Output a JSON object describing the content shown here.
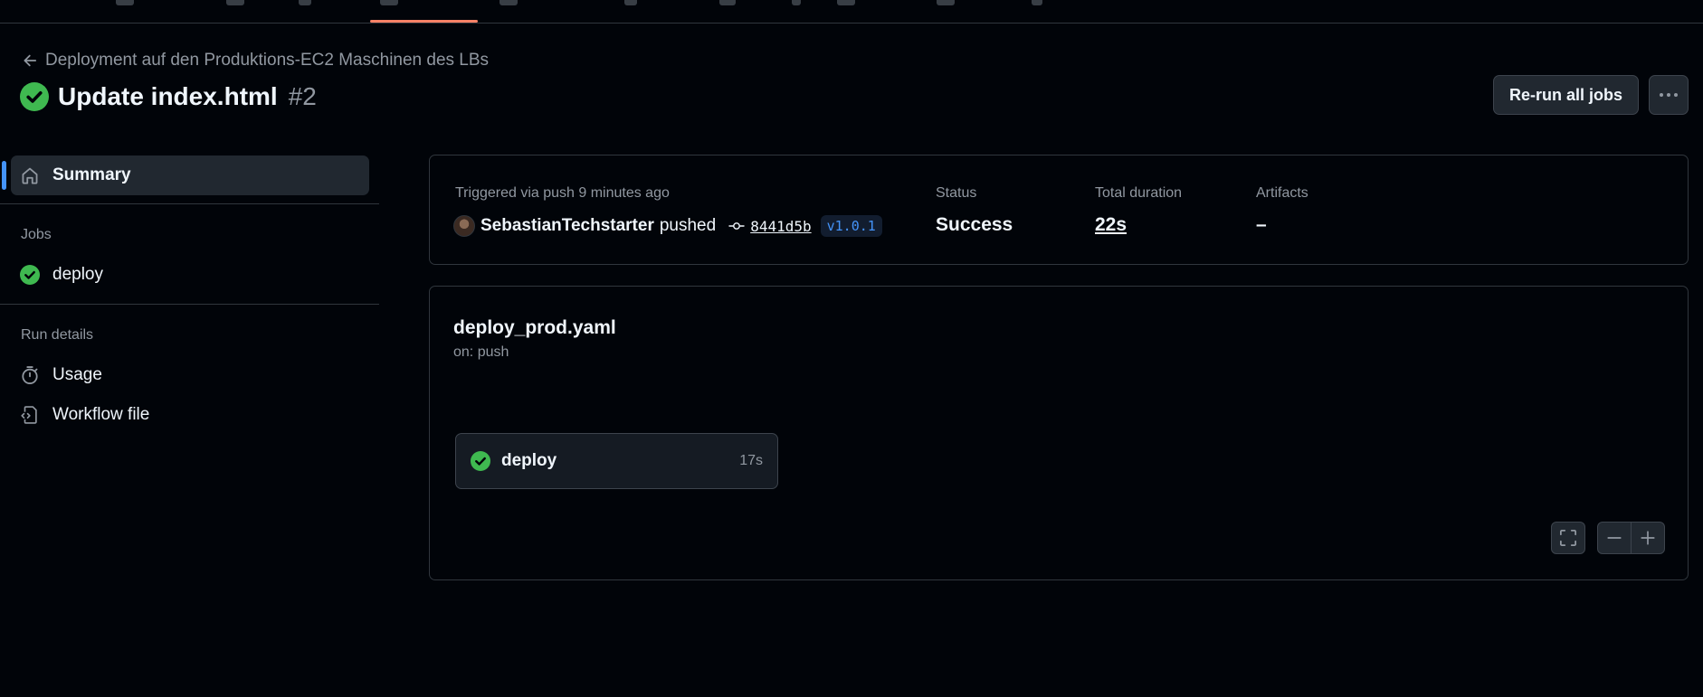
{
  "header": {
    "back_link": "Deployment auf den Produktions-EC2 Maschinen des LBs",
    "title": "Update index.html",
    "run_number": "#2",
    "rerun_button": "Re-run all jobs",
    "more_button": "···"
  },
  "sidebar": {
    "summary": "Summary",
    "jobs_heading": "Jobs",
    "jobs": [
      {
        "label": "deploy",
        "status": "success"
      }
    ],
    "run_details_heading": "Run details",
    "usage": "Usage",
    "workflow_file": "Workflow file"
  },
  "summary": {
    "trigger_text": "Triggered via push 9 minutes ago",
    "actor": "SebastianTechstarter",
    "action": "pushed",
    "commit_sha": "8441d5b",
    "tag": "v1.0.1",
    "status_label": "Status",
    "status_value": "Success",
    "duration_label": "Total duration",
    "duration_value": "22s",
    "artifacts_label": "Artifacts",
    "artifacts_value": "–"
  },
  "workflow": {
    "file": "deploy_prod.yaml",
    "trigger": "on: push",
    "job_name": "deploy",
    "job_duration": "17s"
  },
  "colors": {
    "background": "#010409",
    "success_green": "#3fb950",
    "accent_blue": "#4493f8",
    "tab_underline": "#f78166"
  },
  "icons": [
    "arrow-left-icon",
    "check-circle-icon",
    "kebab-icon",
    "home-icon",
    "stopwatch-icon",
    "workflow-file-icon",
    "git-commit-icon",
    "fit-screen-icon",
    "minus-icon",
    "plus-icon"
  ]
}
